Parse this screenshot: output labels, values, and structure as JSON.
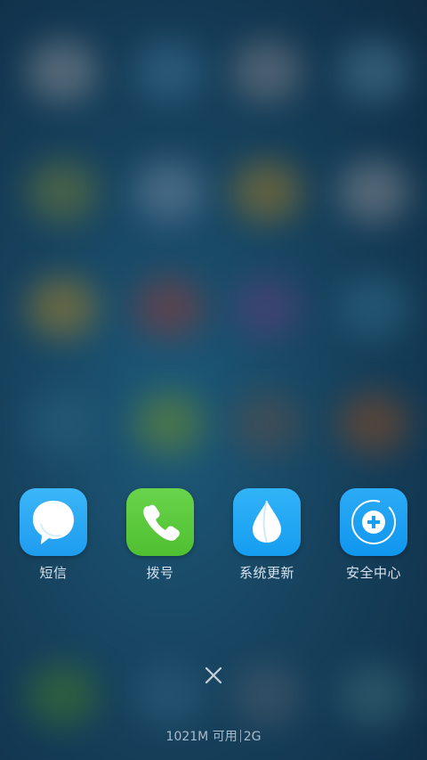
{
  "recent_apps": [
    {
      "label": "短信",
      "icon": "message-bubble-icon",
      "color": "#2AA8F4"
    },
    {
      "label": "拨号",
      "icon": "phone-icon",
      "color": "#5CCB3C"
    },
    {
      "label": "系统更新",
      "icon": "update-drop-icon",
      "color": "#1FA8F2"
    },
    {
      "label": "安全中心",
      "icon": "shield-plus-icon",
      "color": "#169EF0"
    }
  ],
  "memory": {
    "available": "1021M 可用",
    "total": "2G"
  },
  "close_icon": "close-icon"
}
